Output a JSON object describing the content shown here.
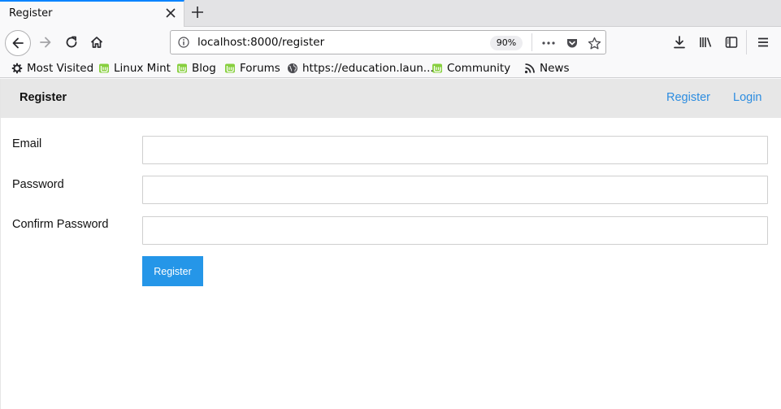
{
  "browser": {
    "tab": {
      "title": "Register"
    },
    "url": "localhost:8000/register",
    "zoom": "90%",
    "bookmarks": [
      {
        "label": "Most Visited",
        "icon": "gear-icon"
      },
      {
        "label": "Linux Mint",
        "icon": "mint-icon"
      },
      {
        "label": "Blog",
        "icon": "mint-icon"
      },
      {
        "label": "Forums",
        "icon": "mint-icon"
      },
      {
        "label": "https://education.laun...",
        "icon": "globe-icon"
      },
      {
        "label": "Community",
        "icon": "mint-icon"
      },
      {
        "label": "News",
        "icon": "rss-icon"
      }
    ]
  },
  "page": {
    "brand": "Register",
    "nav": {
      "register": "Register",
      "login": "Login"
    },
    "form": {
      "email_label": "Email",
      "email_value": "",
      "password_label": "Password",
      "password_value": "",
      "confirm_label": "Confirm Password",
      "confirm_value": "",
      "submit_label": "Register"
    }
  },
  "colors": {
    "accent": "#2596e8",
    "link": "#2d8de0",
    "tab_highlight": "#0a84ff",
    "header_bg": "#e7e7e7"
  }
}
